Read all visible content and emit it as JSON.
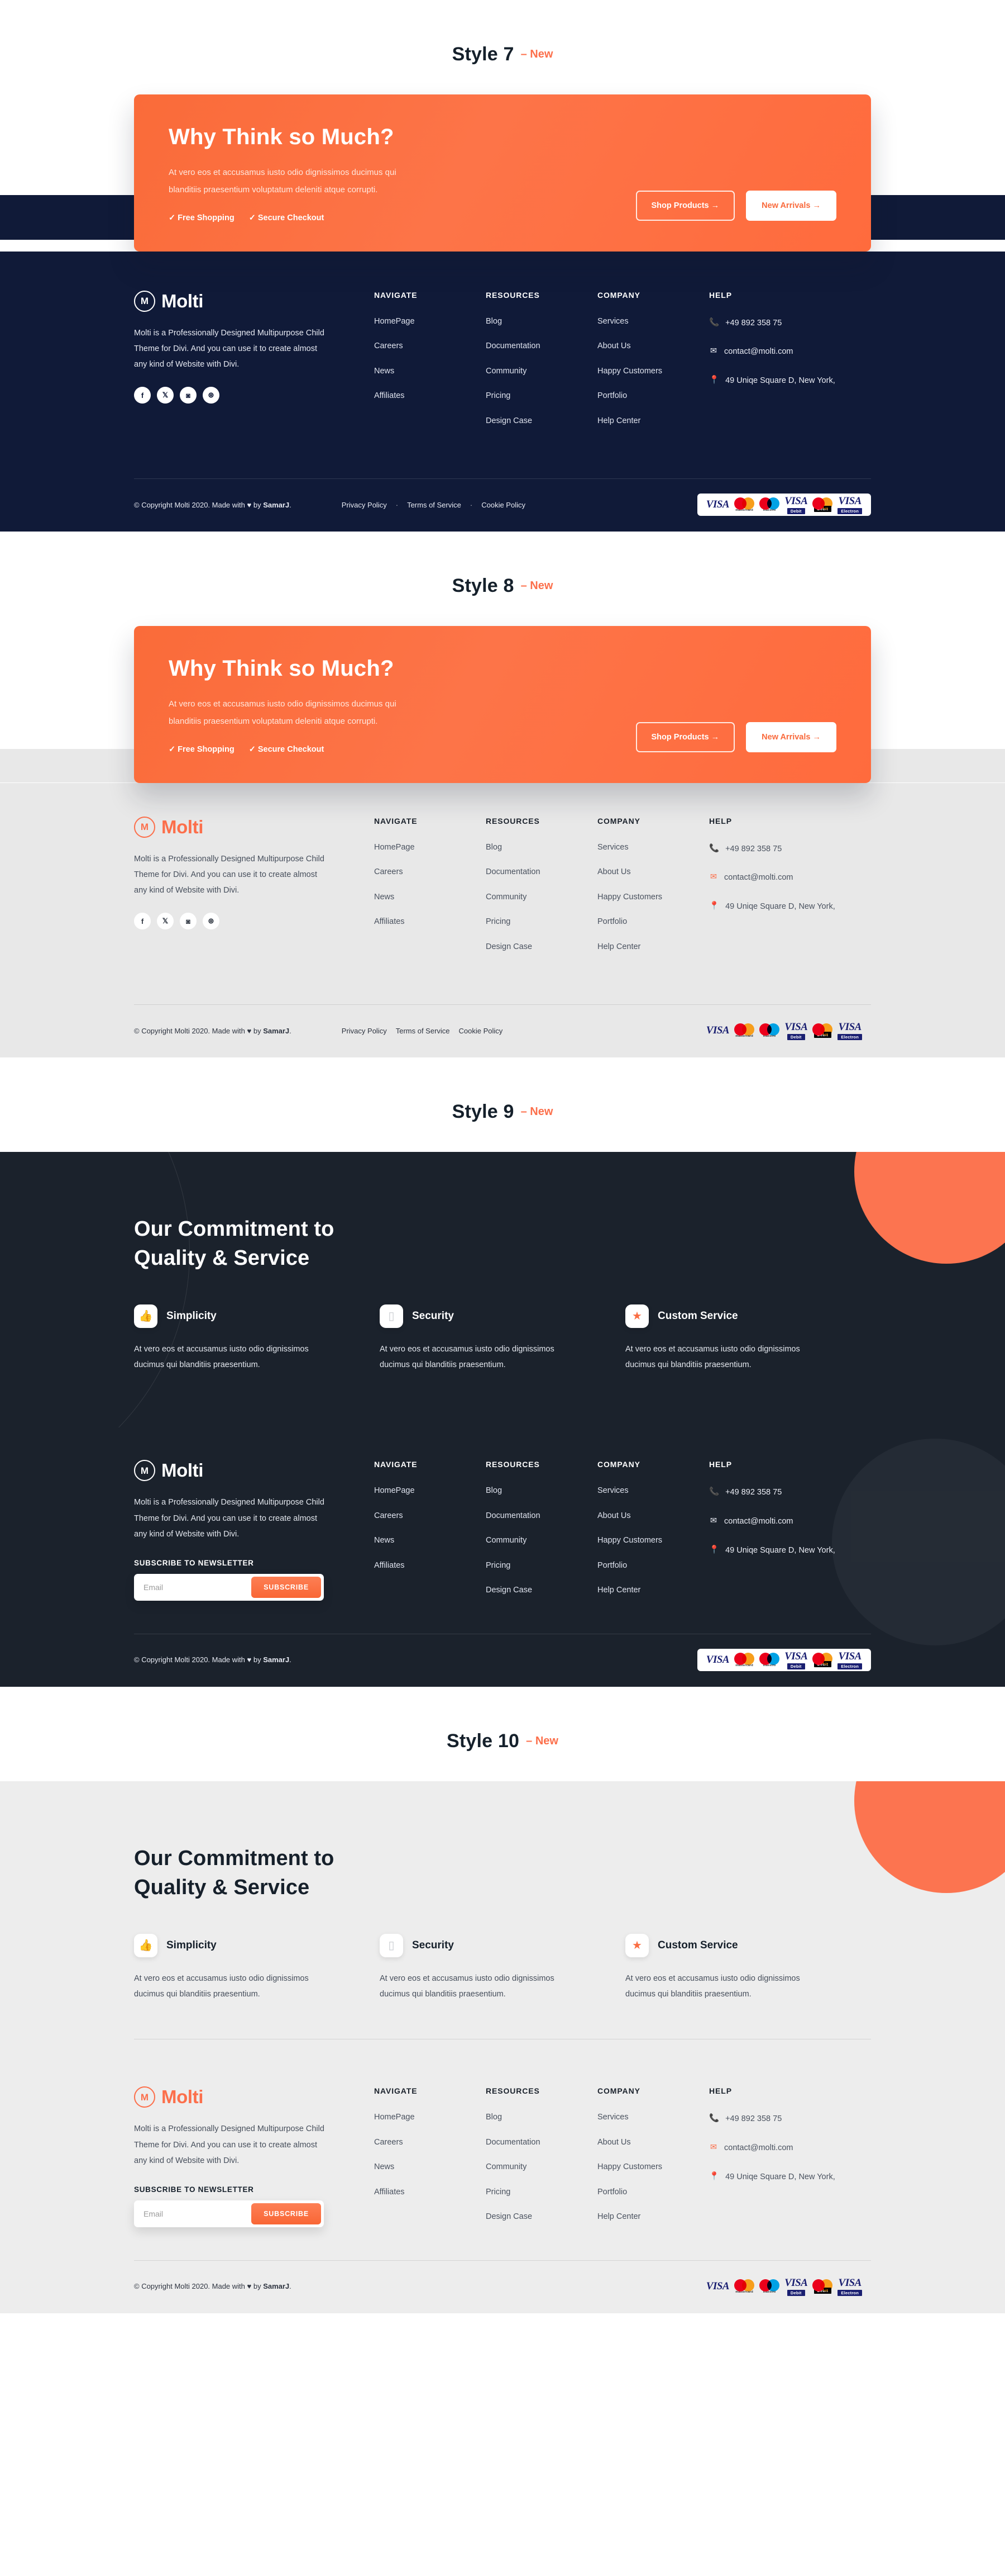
{
  "brand": {
    "name": "Molti",
    "mark": "M",
    "accent": "#fc6f4b",
    "dark_navy": "#101a38",
    "dark_slate": "#1b222c",
    "light_grey": "#e8e8e8"
  },
  "styles": [
    {
      "title": "Style 7",
      "new_label": "– New"
    },
    {
      "title": "Style 8",
      "new_label": "– New"
    },
    {
      "title": "Style 9",
      "new_label": "– New"
    },
    {
      "title": "Style 10",
      "new_label": "– New"
    }
  ],
  "cta": {
    "heading": "Why Think so Much?",
    "paragraph": "At vero eos et accusamus iusto odio dignissimos ducimus qui blanditiis praesentium voluptatum deleniti atque corrupti.",
    "perks": [
      "✓ Free Shopping",
      "✓ Secure Checkout"
    ],
    "primary_button": "Shop Products  →",
    "secondary_button": "New Arrivals  →"
  },
  "footer": {
    "about": "Molti is a Professionally Designed Multipurpose Child Theme for Divi. And you can use it to create almost any kind of Website with Divi.",
    "socials": [
      {
        "name": "facebook-icon",
        "glyph": "f"
      },
      {
        "name": "x-twitter-icon",
        "glyph": "𝕏"
      },
      {
        "name": "instagram-icon",
        "glyph": "◙"
      },
      {
        "name": "dribbble-icon",
        "glyph": "⊛"
      }
    ],
    "columns": [
      {
        "heading": "NAVIGATE",
        "links": [
          "HomePage",
          "Careers",
          "News",
          "Affiliates"
        ]
      },
      {
        "heading": "RESOURCES",
        "links": [
          "Blog",
          "Documentation",
          "Community",
          "Pricing",
          "Design Case"
        ]
      },
      {
        "heading": "COMPANY",
        "links": [
          "Services",
          "About Us",
          "Happy Customers",
          "Portfolio",
          "Help Center"
        ]
      }
    ],
    "help": {
      "heading": "HELP",
      "phone": "+49 892 358 75",
      "phone_icon": "📞",
      "email": "contact@molti.com",
      "email_icon": "✉",
      "address": "49 Uniqe Square D, New York,",
      "address_icon": "📍"
    },
    "newsletter": {
      "title": "SUBSCRIBE TO NEWSLETTER",
      "placeholder": "Email",
      "value": "",
      "button": "SUBSCRIBE"
    },
    "copyright": "© Copyright Molti 2020. Made with ♥ by ",
    "copyright_author": "SamarJ",
    "copyright_end": ".",
    "legal": [
      "Privacy Policy",
      "Terms of Service",
      "Cookie Policy"
    ],
    "legal_separator": "·",
    "payments": [
      {
        "name": "visa",
        "label": "VISA",
        "sub": ""
      },
      {
        "name": "mastercard",
        "label": "",
        "sub": "mastercard"
      },
      {
        "name": "maestro",
        "label": "",
        "sub": "maestro"
      },
      {
        "name": "visa-debit",
        "label": "VISA",
        "sub": "Debit"
      },
      {
        "name": "mastercard-debit",
        "label": "",
        "sub": "Debit"
      },
      {
        "name": "visa-electron",
        "label": "VISA",
        "sub": "Electron"
      }
    ]
  },
  "commitment": {
    "heading_line1": "Our Commitment to",
    "heading_line2": "Quality & Service",
    "features": [
      {
        "title": "Simplicity",
        "icon": "thumbs-up-icon",
        "glyph": "👍",
        "text": "At vero eos et accusamus iusto odio dignissimos ducimus qui blanditiis praesentium."
      },
      {
        "title": "Security",
        "icon": "shield-icon",
        "glyph": "▯",
        "text": "At vero eos et accusamus iusto odio dignissimos ducimus qui blanditiis praesentium."
      },
      {
        "title": "Custom Service",
        "icon": "star-icon",
        "glyph": "★",
        "text": "At vero eos et accusamus iusto odio dignissimos ducimus qui blanditiis praesentium."
      }
    ]
  }
}
